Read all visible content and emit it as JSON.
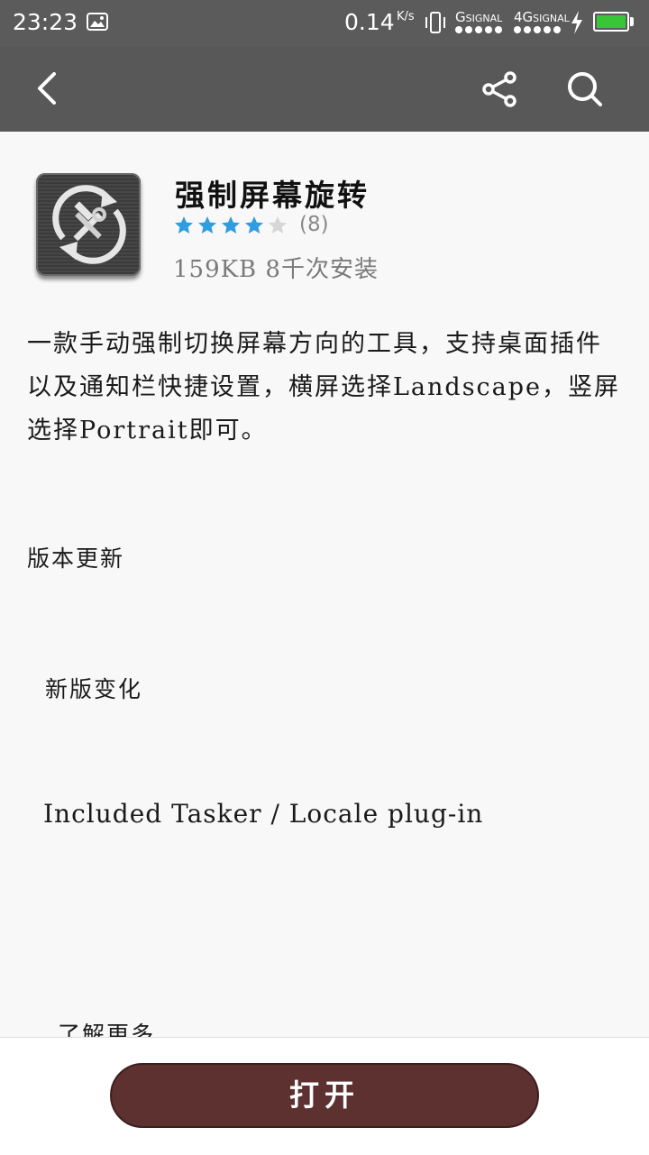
{
  "status_bar": {
    "time": "23:23",
    "net_speed": "0.14",
    "net_speed_unit": "K/s",
    "sim1_label_big": "G",
    "sim1_label": "SIGNAL",
    "sim2_label_big": "4G",
    "sim2_label": "SIGNAL",
    "battery_level": 1.0,
    "battery_color": "#38c638",
    "icons": [
      "gallery-icon",
      "vibrate-icon",
      "signal-icon",
      "charging-icon",
      "battery-icon"
    ]
  },
  "app_bar": {
    "icons": [
      "back-arrow-icon",
      "share-icon",
      "search-icon"
    ],
    "background": "#585858"
  },
  "app": {
    "name": "强制屏幕旋转",
    "rating": 4,
    "rating_max": 5,
    "rating_count": "(8)",
    "meta": "159KB 8千次安装",
    "star_color": "#2f9de0"
  },
  "description": "一款手动强制切换屏幕方向的工具，支持桌面插件以及通知栏快捷设置，横屏选择Landscape，竖屏选择Portrait即可。",
  "update_section": {
    "heading": "版本更新",
    "subheading": "新版变化",
    "changes": "Included Tasker / Locale plug-in",
    "learn_more": "了解更多"
  },
  "bottom_bar": {
    "open_label": "打开",
    "button_color": "#5c312f"
  }
}
